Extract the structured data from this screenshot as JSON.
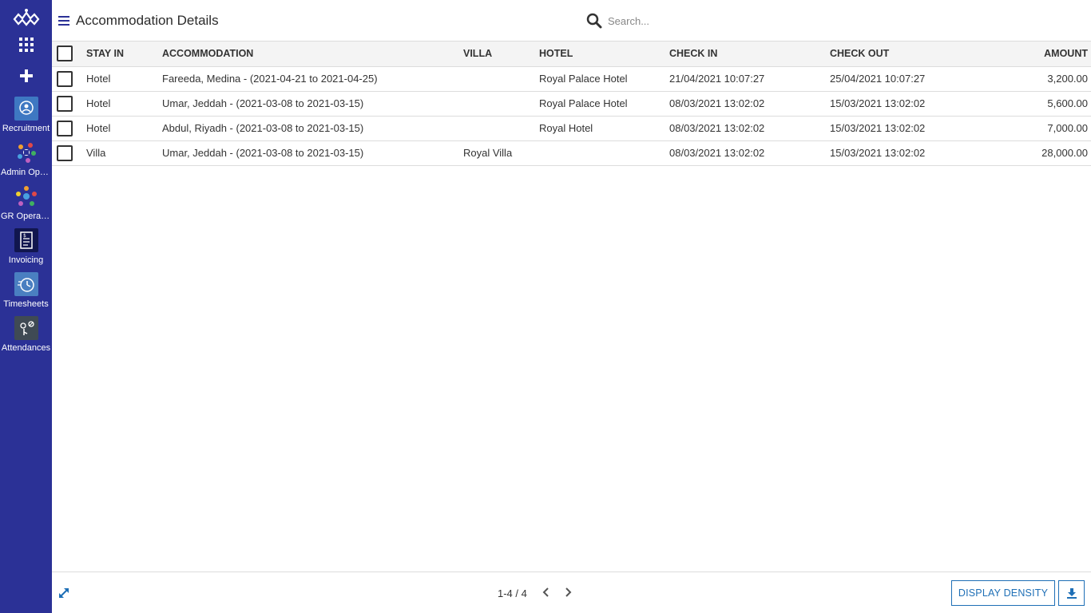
{
  "sidebar": {
    "apps": [
      {
        "label": "Recruitment",
        "icon": "recruitment-icon",
        "color": "#3e78c2"
      },
      {
        "label": "Admin Oper...",
        "icon": "admin-operations-icon",
        "color": "#2b3196"
      },
      {
        "label": "GR Operatio...",
        "icon": "gr-operations-icon",
        "color": "#2b3196"
      },
      {
        "label": "Invoicing",
        "icon": "invoicing-icon",
        "color": "#11164f"
      },
      {
        "label": "Timesheets",
        "icon": "timesheets-icon",
        "color": "#4a7fc1"
      },
      {
        "label": "Attendances",
        "icon": "attendances-icon",
        "color": "#3f4a54"
      }
    ]
  },
  "header": {
    "title": "Accommodation Details",
    "search_placeholder": "Search..."
  },
  "table": {
    "columns": [
      "STAY IN",
      "ACCOMMODATION",
      "VILLA",
      "HOTEL",
      "CHECK IN",
      "CHECK OUT",
      "AMOUNT"
    ],
    "rows": [
      {
        "stay_in": "Hotel",
        "accommodation": "Fareeda, Medina - (2021-04-21 to 2021-04-25)",
        "villa": "",
        "hotel": "Royal Palace Hotel",
        "check_in": "21/04/2021 10:07:27",
        "check_out": "25/04/2021 10:07:27",
        "amount": "3,200.00"
      },
      {
        "stay_in": "Hotel",
        "accommodation": "Umar, Jeddah - (2021-03-08 to 2021-03-15)",
        "villa": "",
        "hotel": "Royal Palace Hotel",
        "check_in": "08/03/2021 13:02:02",
        "check_out": "15/03/2021 13:02:02",
        "amount": "5,600.00"
      },
      {
        "stay_in": "Hotel",
        "accommodation": "Abdul, Riyadh - (2021-03-08 to 2021-03-15)",
        "villa": "",
        "hotel": "Royal Hotel",
        "check_in": "08/03/2021 13:02:02",
        "check_out": "15/03/2021 13:02:02",
        "amount": "7,000.00"
      },
      {
        "stay_in": "Villa",
        "accommodation": "Umar, Jeddah - (2021-03-08 to 2021-03-15)",
        "villa": "Royal Villa",
        "hotel": "",
        "check_in": "08/03/2021 13:02:02",
        "check_out": "15/03/2021 13:02:02",
        "amount": "28,000.00"
      }
    ]
  },
  "footer": {
    "pager": "1-4 / 4",
    "density_label": "DISPLAY DENSITY"
  },
  "colors": {
    "sidebar_bg": "#2b3196",
    "accent": "#1e6fb6"
  }
}
